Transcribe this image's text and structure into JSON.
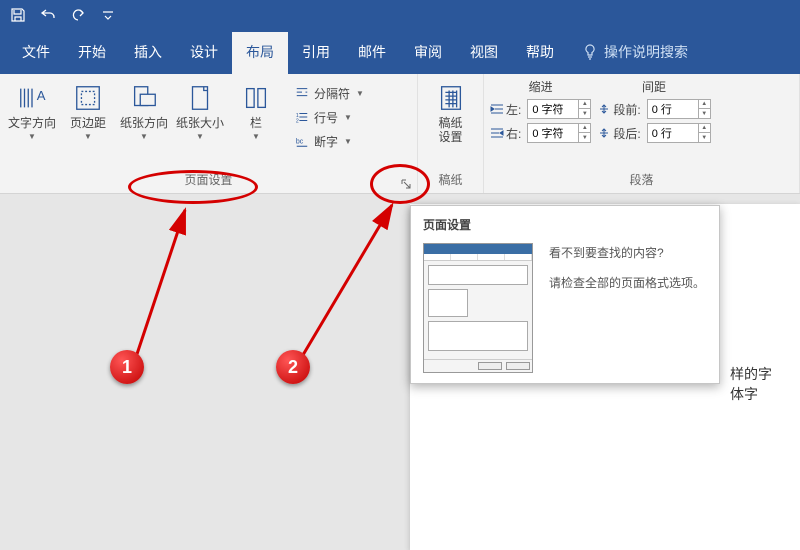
{
  "tabs": {
    "file": "文件",
    "home": "开始",
    "insert": "插入",
    "design": "设计",
    "layout": "布局",
    "references": "引用",
    "mailings": "邮件",
    "review": "审阅",
    "view": "视图",
    "help": "帮助",
    "tellme": "操作说明搜索"
  },
  "page_setup": {
    "text_direction": "文字方向",
    "margins": "页边距",
    "orientation": "纸张方向",
    "size": "纸张大小",
    "columns": "栏",
    "breaks": "分隔符",
    "line_numbers": "行号",
    "hyphenation": "断字",
    "group_label": "页面设置"
  },
  "manuscript": {
    "settings": "稿纸\n设置",
    "group_label": "稿纸"
  },
  "paragraph": {
    "indent_header": "缩进",
    "spacing_header": "间距",
    "left_label": "左:",
    "right_label": "右:",
    "before_label": "段前:",
    "after_label": "段后:",
    "left_value": "0 字符",
    "right_value": "0 字符",
    "before_value": "0 行",
    "after_value": "0 行",
    "group_label": "段落"
  },
  "tooltip": {
    "title": "页面设置",
    "q": "看不到要查找的内容?",
    "desc": "请检查全部的页面格式选项。"
  },
  "document_snippet": "样的字体字",
  "annotations": {
    "badge1": "1",
    "badge2": "2"
  }
}
